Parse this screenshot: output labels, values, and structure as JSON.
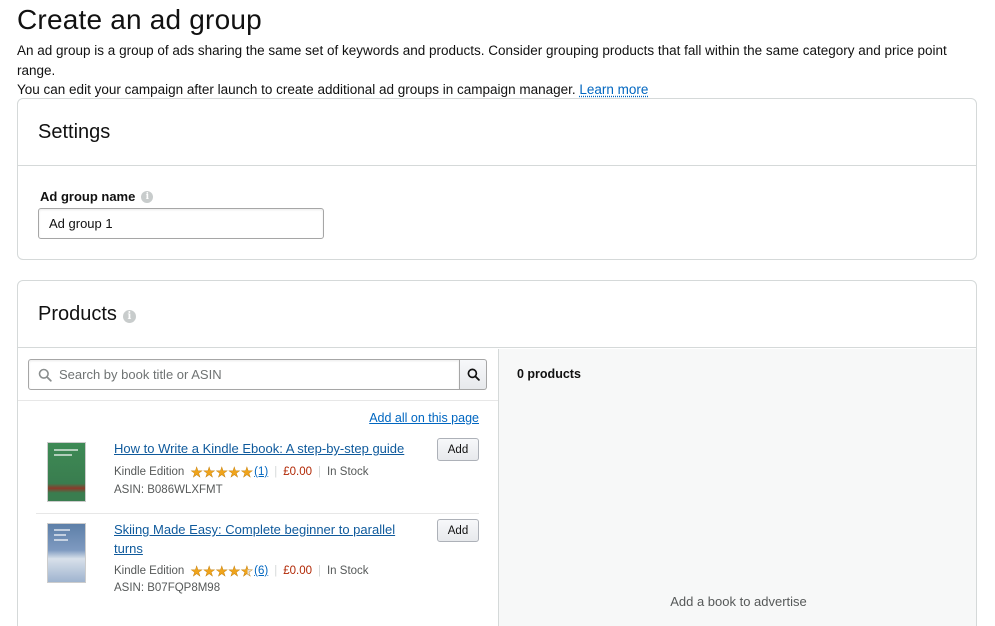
{
  "page": {
    "title": "Create an ad group",
    "intro_line1": "An ad group is a group of ads sharing the same set of keywords and products. Consider grouping products that fall within the same category and price point range.",
    "intro_line2": "You can edit your campaign after launch to create additional ad groups in campaign manager.",
    "learn_more": "Learn more"
  },
  "settings": {
    "title": "Settings",
    "ad_group_name_label": "Ad group name",
    "ad_group_name_value": "Ad group 1"
  },
  "products": {
    "title": "Products",
    "search_placeholder": "Search by book title or ASIN",
    "add_all_label": "Add all on this page",
    "count_label": "0 products",
    "empty_message": "Add a book to advertise",
    "items": [
      {
        "title": "How to Write a Kindle Ebook: A step-by-step guide",
        "format": "Kindle Edition",
        "rating": 5,
        "reviews": "(1)",
        "price": "£0.00",
        "stock": "In Stock",
        "asin": "ASIN: B086WLXFMT",
        "add_label": "Add"
      },
      {
        "title": "Skiing Made Easy: Complete beginner to parallel turns",
        "format": "Kindle Edition",
        "rating": 4.5,
        "reviews": "(6)",
        "price": "£0.00",
        "stock": "In Stock",
        "asin": "ASIN: B07FQP8M98",
        "add_label": "Add"
      }
    ]
  },
  "colors": {
    "link": "#0066c0",
    "price": "#b12704",
    "star": "#f0a41b",
    "border": "#d5d9d9"
  }
}
